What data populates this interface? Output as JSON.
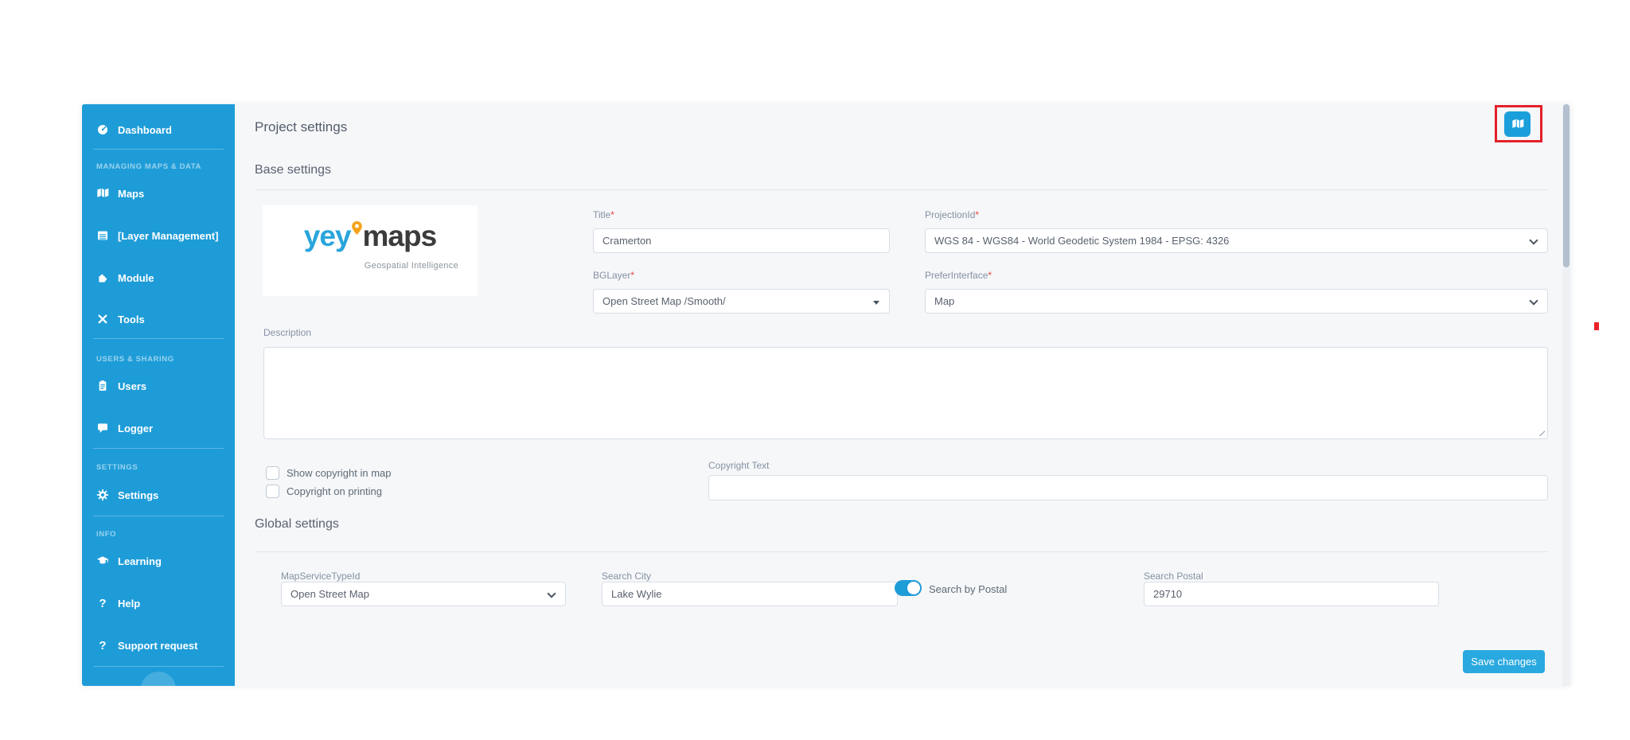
{
  "window": {
    "title": "Project settings"
  },
  "sidebar": {
    "items": [
      {
        "label": "Dashboard"
      },
      {
        "label": "Maps"
      },
      {
        "label": "[Layer Management]"
      },
      {
        "label": "Module"
      },
      {
        "label": "Tools"
      },
      {
        "label": "Users"
      },
      {
        "label": "Logger"
      },
      {
        "label": "Settings"
      },
      {
        "label": "Learning"
      },
      {
        "label": "Help"
      },
      {
        "label": "Support request"
      }
    ],
    "section_labels": [
      "MANAGING MAPS & DATA",
      "USERS & SHARING",
      "SETTINGS",
      "INFO"
    ],
    "help_glyph": "?"
  },
  "logo": {
    "part1": "yey",
    "part2": "maps",
    "subtitle": "Geospatial Intelligence"
  },
  "headings": {
    "base": "Base settings",
    "global": "Global settings"
  },
  "required_mark": "*",
  "fields": {
    "title": {
      "label": "Title",
      "value": "Cramerton"
    },
    "projection": {
      "label": "ProjectionId",
      "value": "WGS 84 - WGS84 - World Geodetic System 1984 - EPSG: 4326"
    },
    "bglayer": {
      "label": "BGLayer",
      "value": "Open Street Map /Smooth/"
    },
    "prefer_interface": {
      "label": "PreferInterface",
      "value": "Map"
    },
    "description": {
      "label": "Description",
      "value": ""
    },
    "show_copyright_in_map": {
      "label": "Show copyright in map",
      "checked": false
    },
    "copyright_on_printing": {
      "label": "Copyright on printing",
      "checked": false
    },
    "copyright_text": {
      "label": "Copyright Text",
      "value": ""
    },
    "map_service_type": {
      "label": "MapServiceTypeId",
      "value": "Open Street Map"
    },
    "search_city": {
      "label": "Search City",
      "value": "Lake Wylie"
    },
    "search_by_postal": {
      "label": "Search by Postal",
      "on": true
    },
    "search_postal": {
      "label": "Search Postal",
      "value": "29710"
    }
  },
  "buttons": {
    "save": "Save changes"
  },
  "colors": {
    "sidebar_blue": "#1e9cd8",
    "accent_blue": "#29a9e0",
    "annotation_red": "#e42029",
    "logo_blue": "#29a5dc",
    "logo_pin_orange": "#f5a31c",
    "logo_dark": "#3b3b3b"
  }
}
